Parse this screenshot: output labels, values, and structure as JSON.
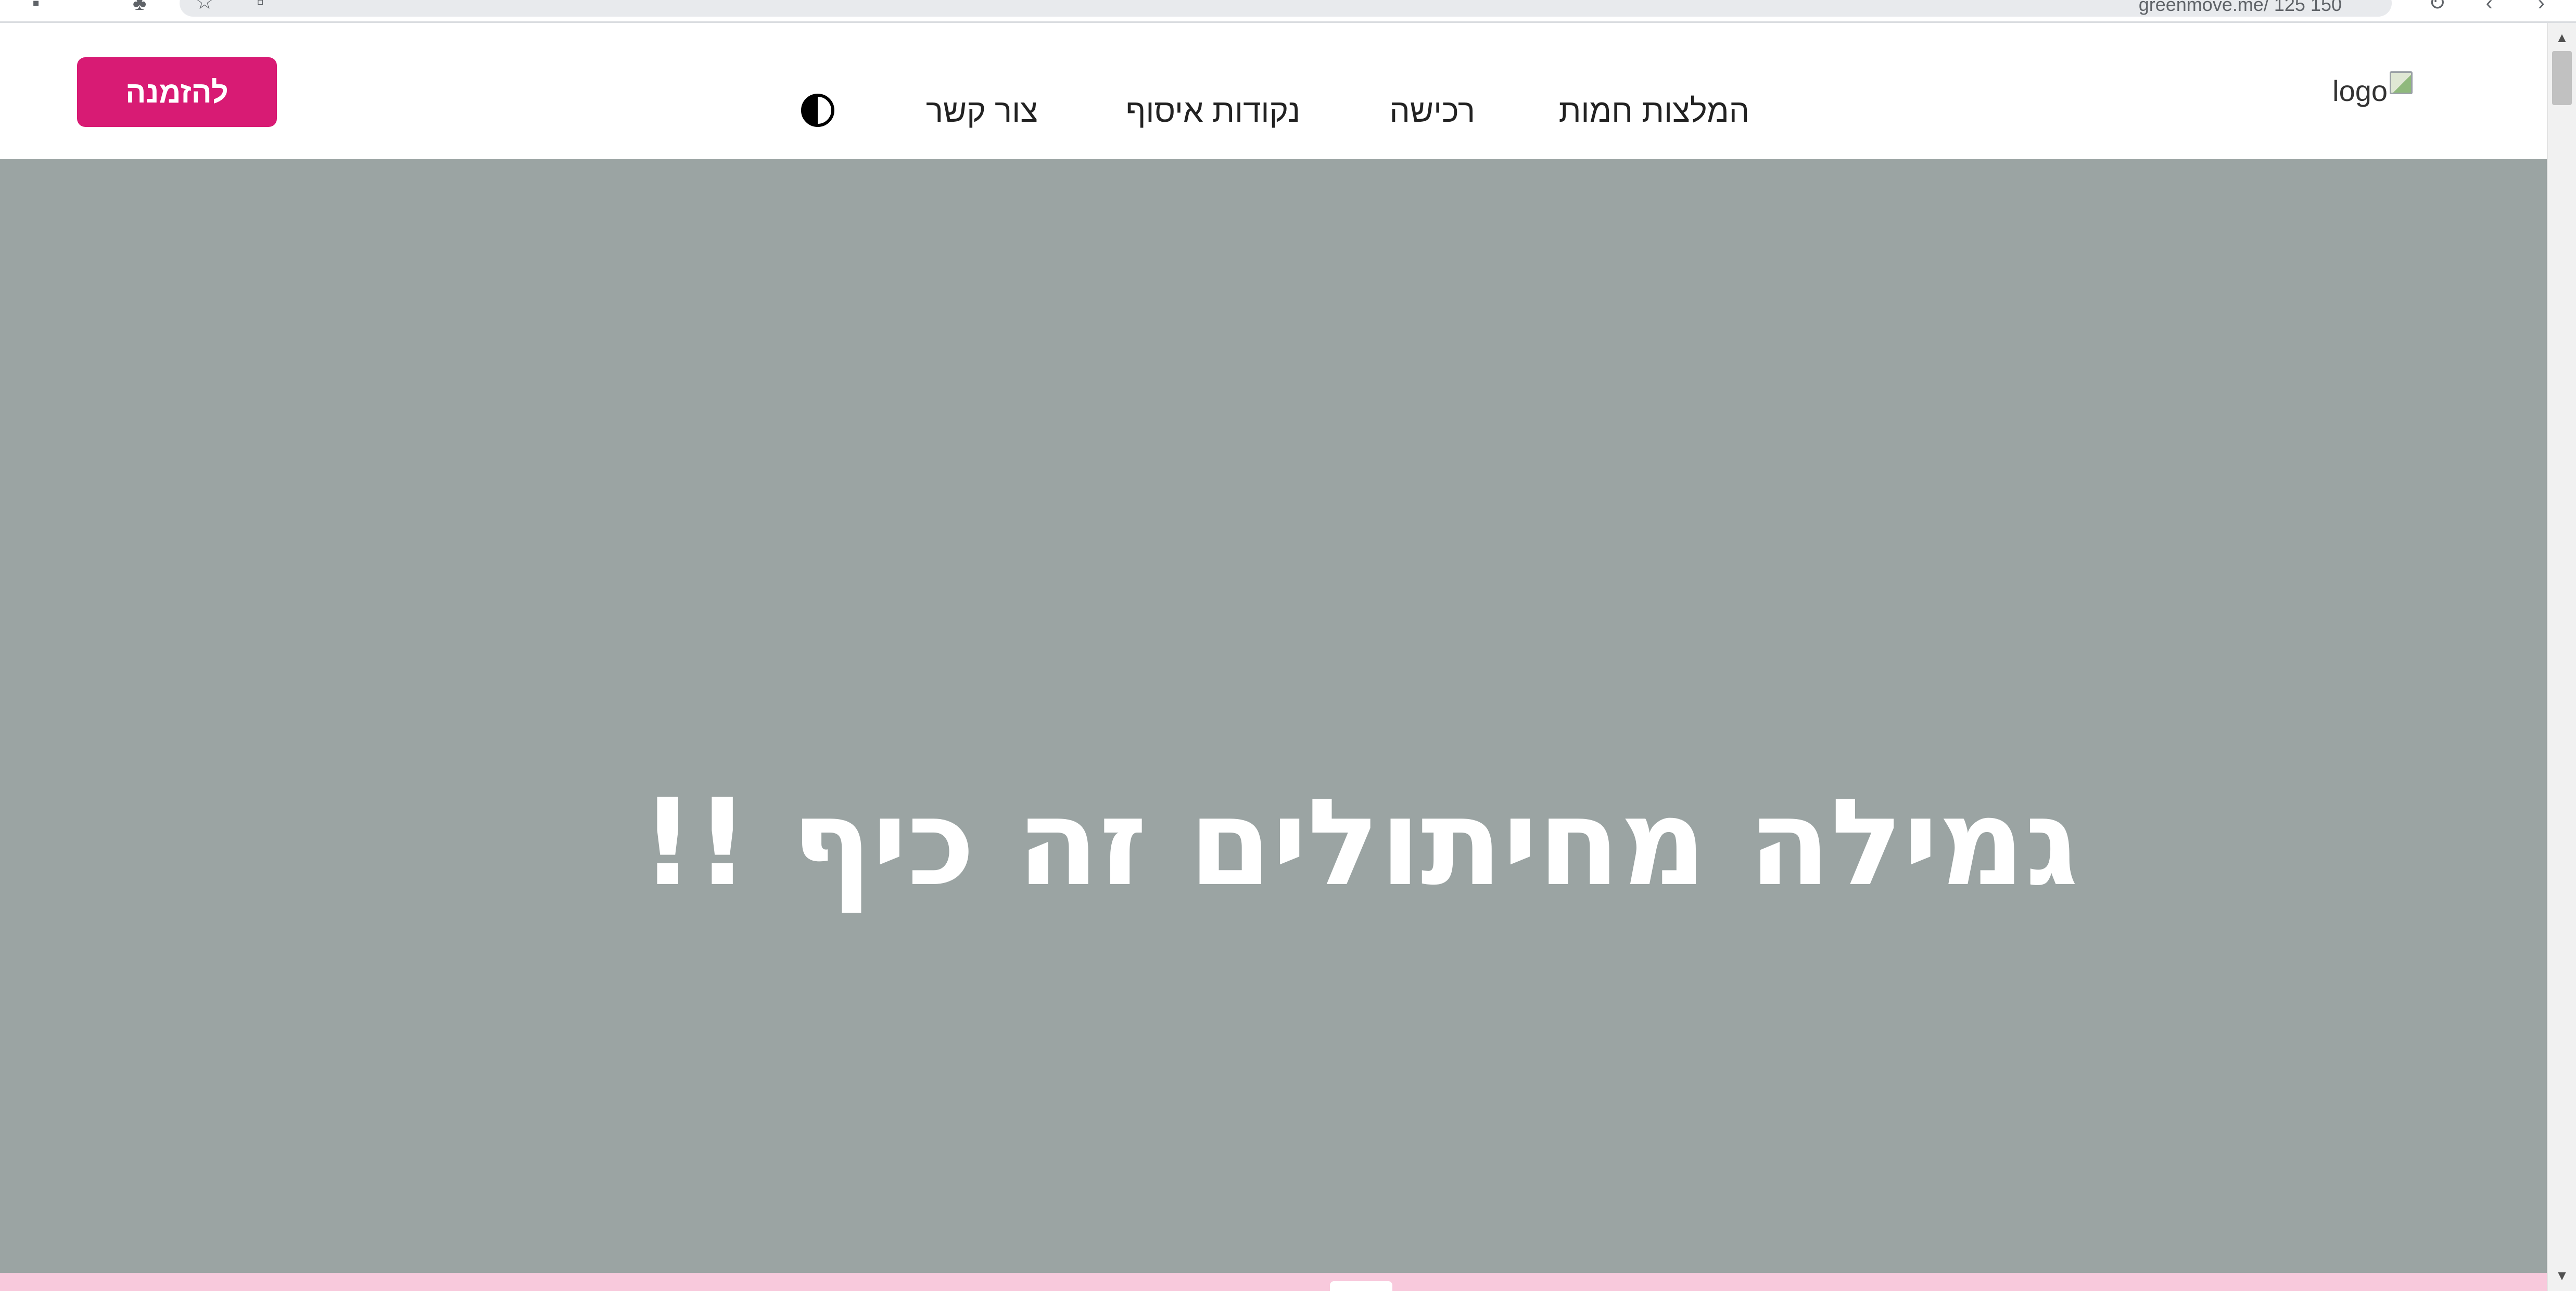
{
  "browser": {
    "url_text": "greenmove.me/ 125 150"
  },
  "header": {
    "logo_alt": "logo",
    "nav": [
      {
        "label": "המלצות חמות"
      },
      {
        "label": "רכישה"
      },
      {
        "label": "נקודות איסוף"
      },
      {
        "label": "צור קשר"
      }
    ],
    "contrast_icon": "contrast-icon",
    "order_button_label": "להזמנה"
  },
  "hero": {
    "title": "גמילה מחיתולים זה כיף !!"
  },
  "colors": {
    "accent": "#d81b74",
    "hero_bg": "#9ba4a3",
    "bottom_strip": "#f8c9dc"
  }
}
